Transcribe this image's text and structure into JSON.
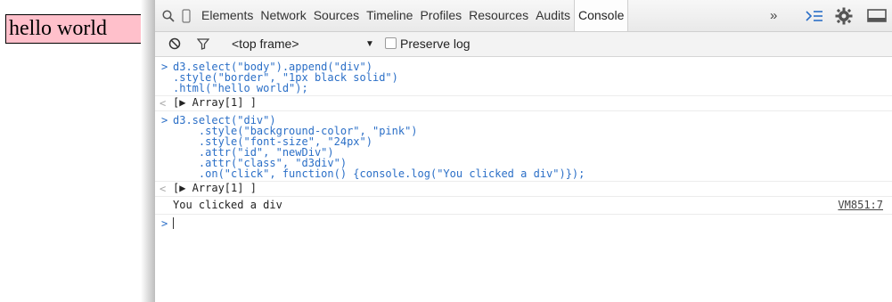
{
  "page": {
    "div_text": "hello world"
  },
  "toolbar": {
    "tabs": [
      "Elements",
      "Network",
      "Sources",
      "Timeline",
      "Profiles",
      "Resources",
      "Audits",
      "Console"
    ],
    "overflow": "»",
    "colors": {
      "accent": "#2b6fc7",
      "pink": "#ffc0cb"
    }
  },
  "filterbar": {
    "frame": "<top frame>",
    "frame_arrow": "▼",
    "preserve_log": "Preserve log"
  },
  "console": {
    "cmd1": [
      "d3.select(\"body\").append(\"div\")",
      ".style(\"border\", \"1px black solid\")",
      ".html(\"hello world\");"
    ],
    "result1": "[▶ Array[1] ]",
    "cmd2": [
      "d3.select(\"div\")",
      "    .style(\"background-color\", \"pink\")",
      "    .style(\"font-size\", \"24px\")",
      "    .attr(\"id\", \"newDiv\")",
      "    .attr(\"class\", \"d3div\")",
      "    .on(\"click\", function() {console.log(\"You clicked a div\")});"
    ],
    "result2": "[▶ Array[1] ]",
    "log_text": "You clicked a div",
    "log_source": "VM851:7",
    "prompt_symbol": ">",
    "result_symbol": "<"
  }
}
